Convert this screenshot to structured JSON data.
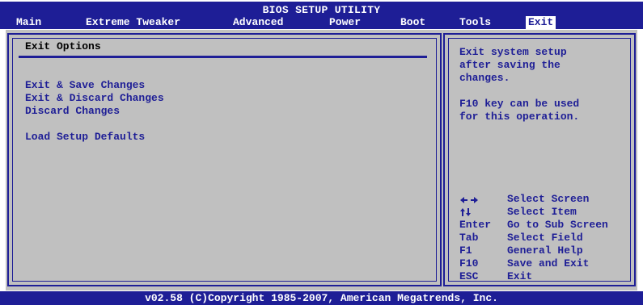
{
  "header": {
    "title": "BIOS SETUP UTILITY",
    "menu": [
      {
        "label": "Main"
      },
      {
        "label": "Extreme Tweaker"
      },
      {
        "label": "Advanced"
      },
      {
        "label": "Power"
      },
      {
        "label": "Boot"
      },
      {
        "label": "Tools"
      },
      {
        "label": "Exit",
        "active": true
      }
    ]
  },
  "exit_panel": {
    "title": "Exit Options",
    "options": [
      {
        "label": "Exit & Save Changes"
      },
      {
        "label": "Exit & Discard Changes"
      },
      {
        "label": "Discard Changes"
      },
      {
        "label": "Load Setup Defaults"
      }
    ]
  },
  "help_panel": {
    "description": [
      "Exit system setup",
      "after saving the",
      "changes.",
      "F10 key can be used",
      "for this operation."
    ],
    "keys": [
      {
        "key_icon": "left-right-arrows-icon",
        "description": "Select Screen"
      },
      {
        "key_icon": "up-down-arrows-icon",
        "description": "Select Item"
      },
      {
        "key": "Enter",
        "description": "Go to Sub Screen"
      },
      {
        "key": "Tab",
        "description": "Select Field"
      },
      {
        "key": "F1",
        "description": "General Help"
      },
      {
        "key": "F10",
        "description": "Save and Exit"
      },
      {
        "key": "ESC",
        "description": "Exit"
      }
    ]
  },
  "footer": {
    "text": "v02.58 (C)Copyright 1985-2007, American Megatrends, Inc."
  },
  "colors": {
    "bios_blue": "#1e1e96",
    "panel_gray": "#c0c0c0",
    "text_white": "#ffffff"
  }
}
